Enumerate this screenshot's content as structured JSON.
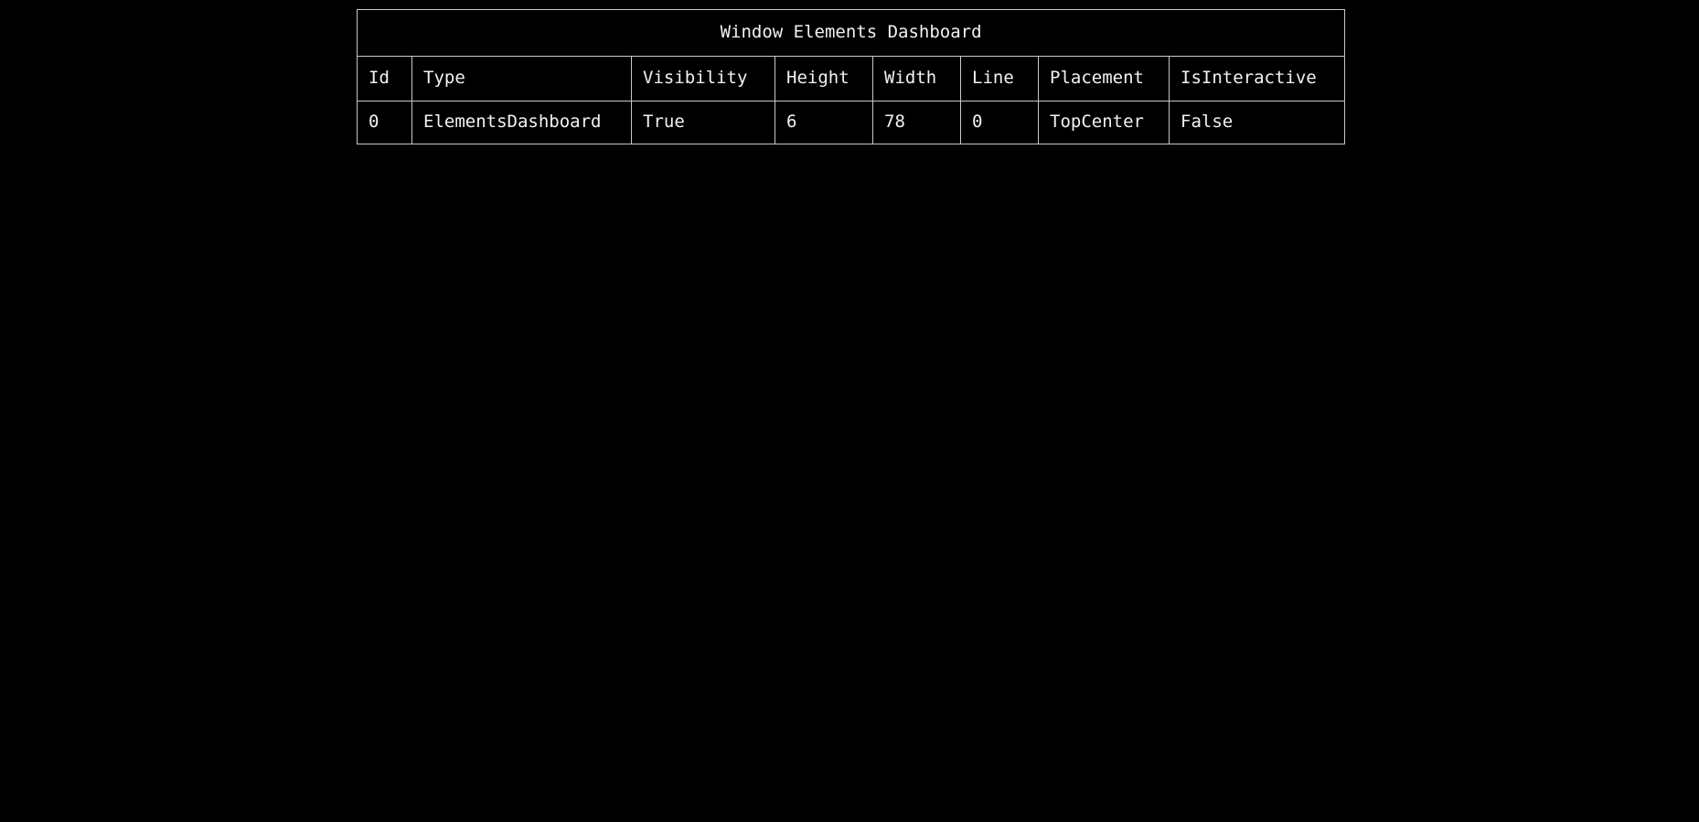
{
  "window": {
    "background_color": "#000000",
    "text_color": "#f2f2f2",
    "border_color": "#c8c8c8"
  },
  "dashboard": {
    "title": "Window Elements Dashboard",
    "columns": [
      "Id",
      "Type",
      "Visibility",
      "Height",
      "Width",
      "Line",
      "Placement",
      "IsInteractive"
    ],
    "rows": [
      {
        "id": "0",
        "type": "ElementsDashboard",
        "visibility": "True",
        "height": "6",
        "width": "78",
        "line": "0",
        "placement": "TopCenter",
        "is_interactive": "False"
      }
    ]
  }
}
